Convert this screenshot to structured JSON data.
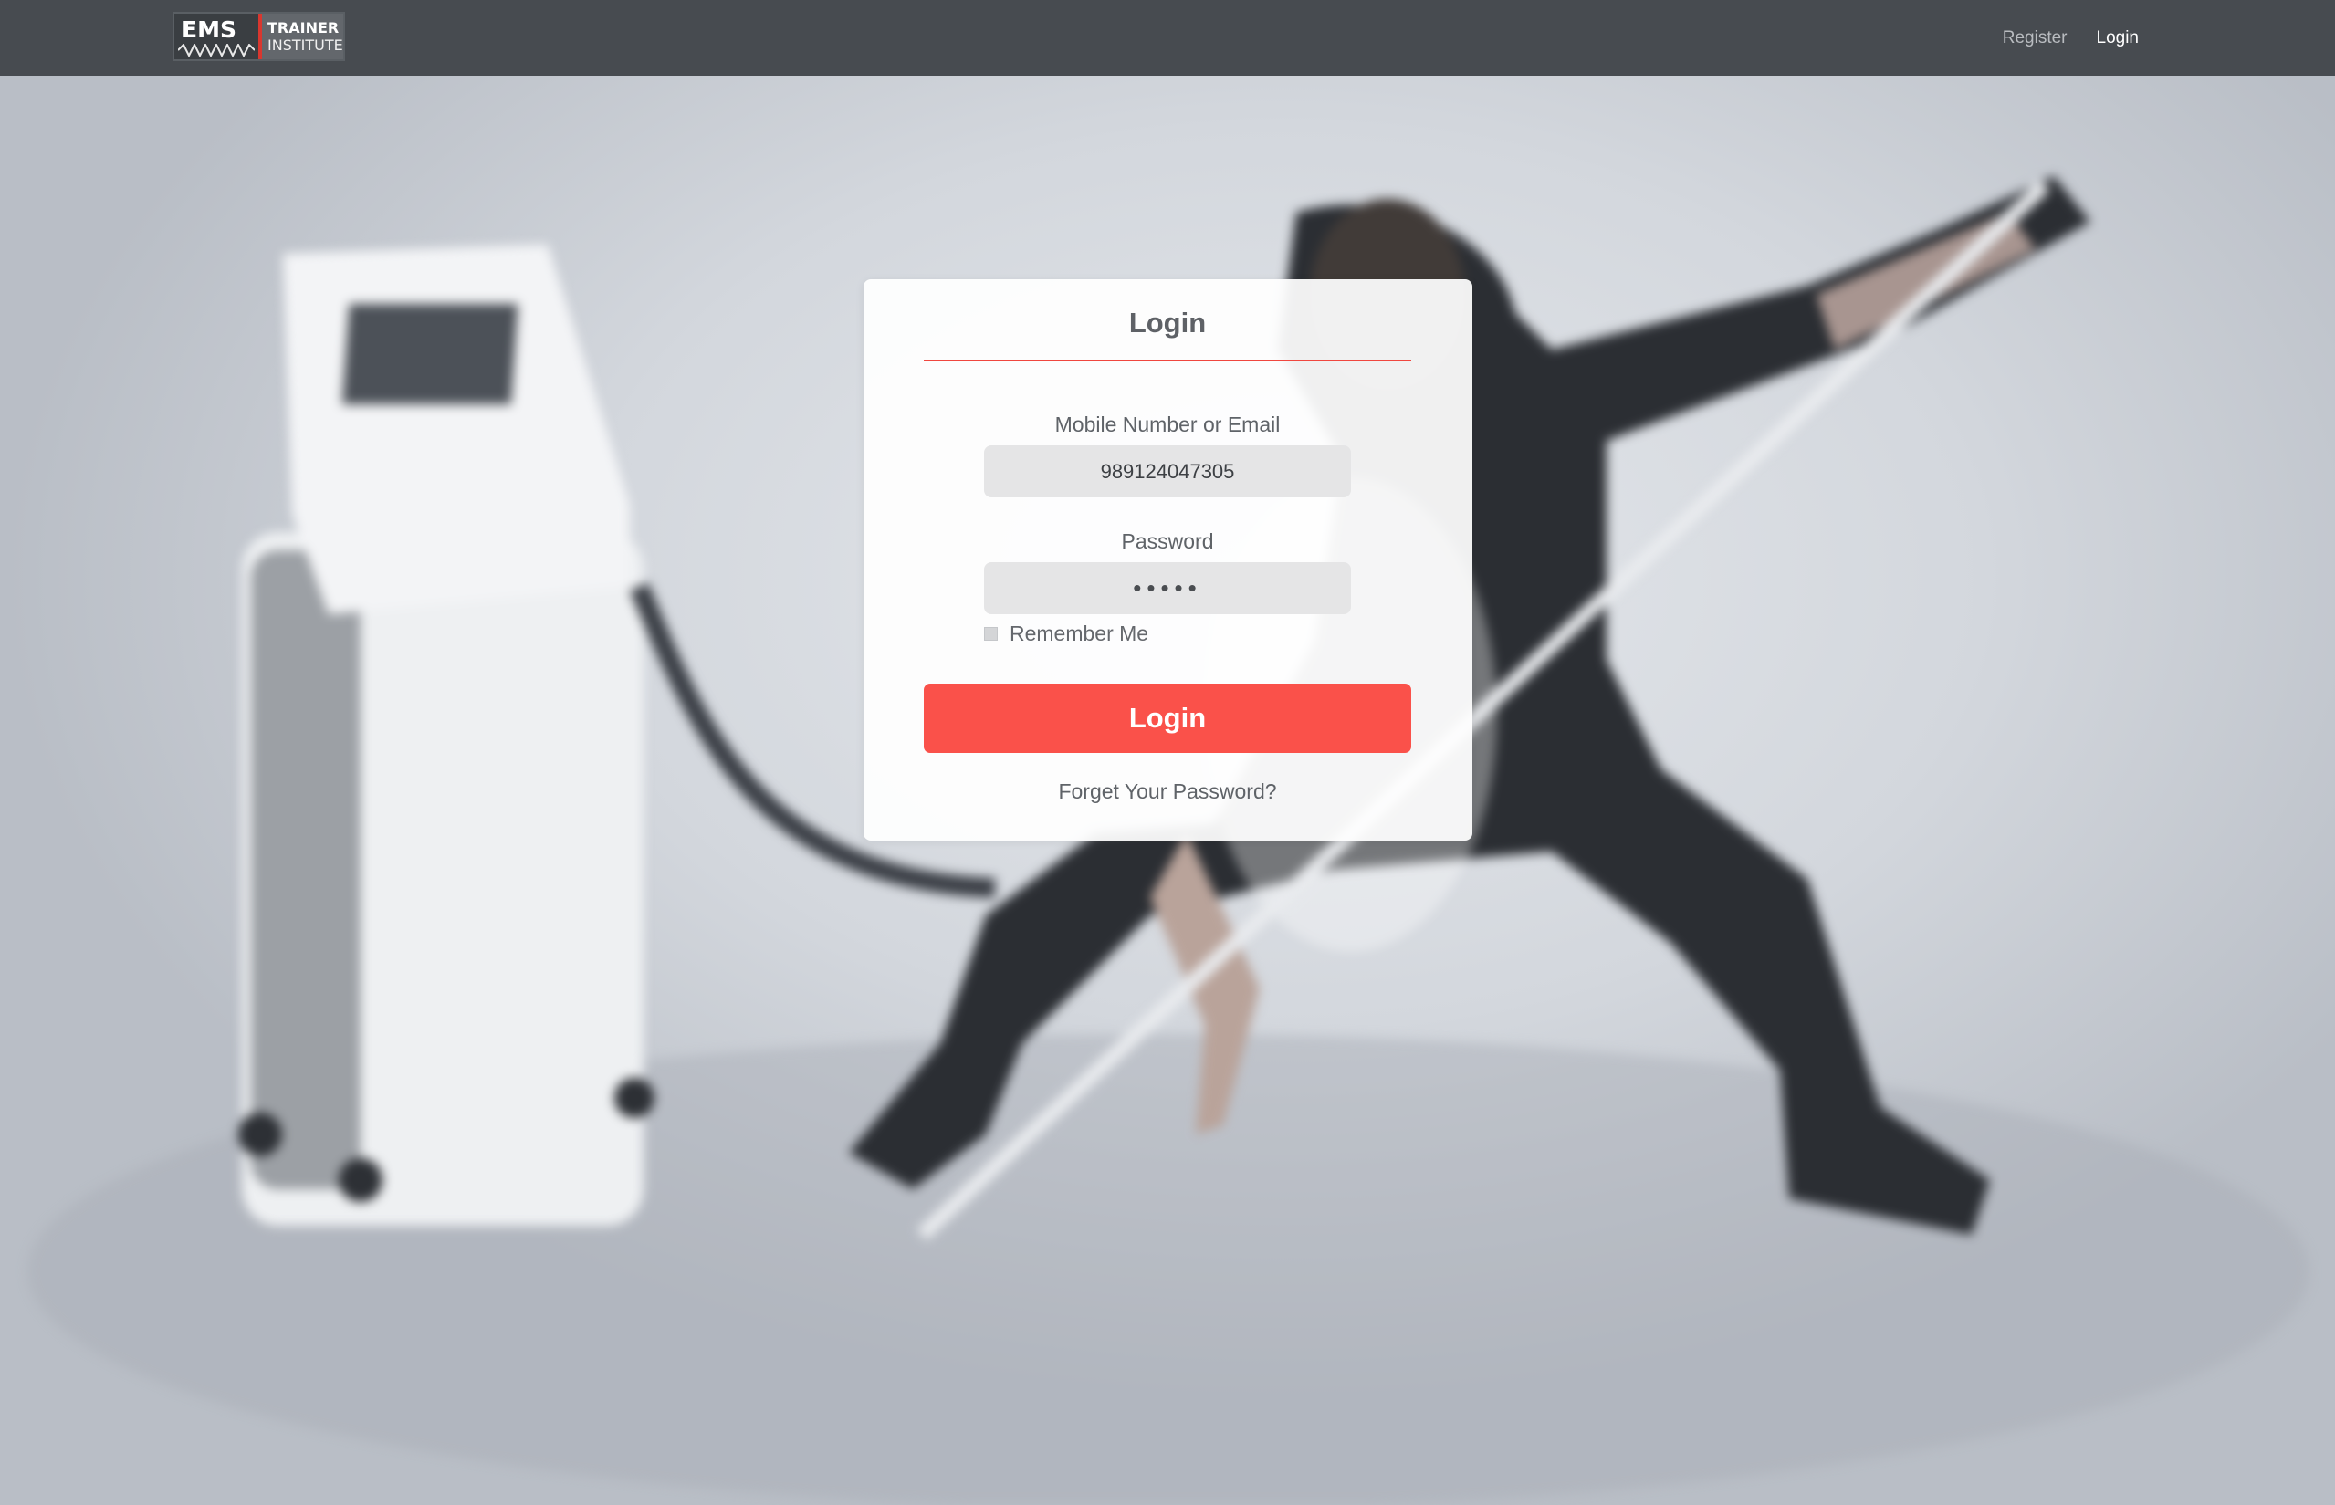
{
  "brand": {
    "logo_main": "EMS",
    "logo_line1": "TRAINER",
    "logo_line2": "INSTITUTE"
  },
  "nav": {
    "register": "Register",
    "login": "Login"
  },
  "login_form": {
    "title": "Login",
    "username_label": "Mobile Number or Email",
    "username_value": "989124047305",
    "password_label": "Password",
    "password_value": "•••••",
    "remember_label": "Remember Me",
    "remember_checked": false,
    "submit_label": "Login",
    "forgot_link": "Forget Your Password?"
  },
  "colors": {
    "navbar": "#474b50",
    "accent": "#fa514a",
    "title_rule": "#f0473f",
    "input_bg": "#e5e5e6"
  }
}
